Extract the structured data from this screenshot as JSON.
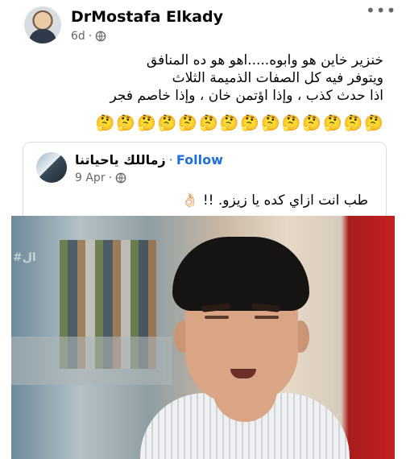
{
  "post": {
    "author": "DrMostafa Elkady",
    "time": "6d",
    "privacy_icon": "globe-icon",
    "more_icon": "more-icon",
    "more_label": "•••",
    "text_lines": [
      "خنزير خاين هو وابوه.....اهو هو ده المنافق",
      "ويتوفر فيه كل الصفات الذميمة الثلاث",
      "اذا حدث كذب ، وإذا اؤتمن خان ، وإذا خاصم فجر"
    ],
    "emoji": "🤔",
    "emoji_count": 14
  },
  "shared_post": {
    "author": "زماللك ياحياتنا",
    "separator": "·",
    "follow_label": "Follow",
    "time": "9 Apr",
    "privacy_icon": "globe-icon",
    "text": "طب انت ازاي كده يا زيزو. !! 👌🏻"
  },
  "image": {
    "watermark": "#ال"
  }
}
